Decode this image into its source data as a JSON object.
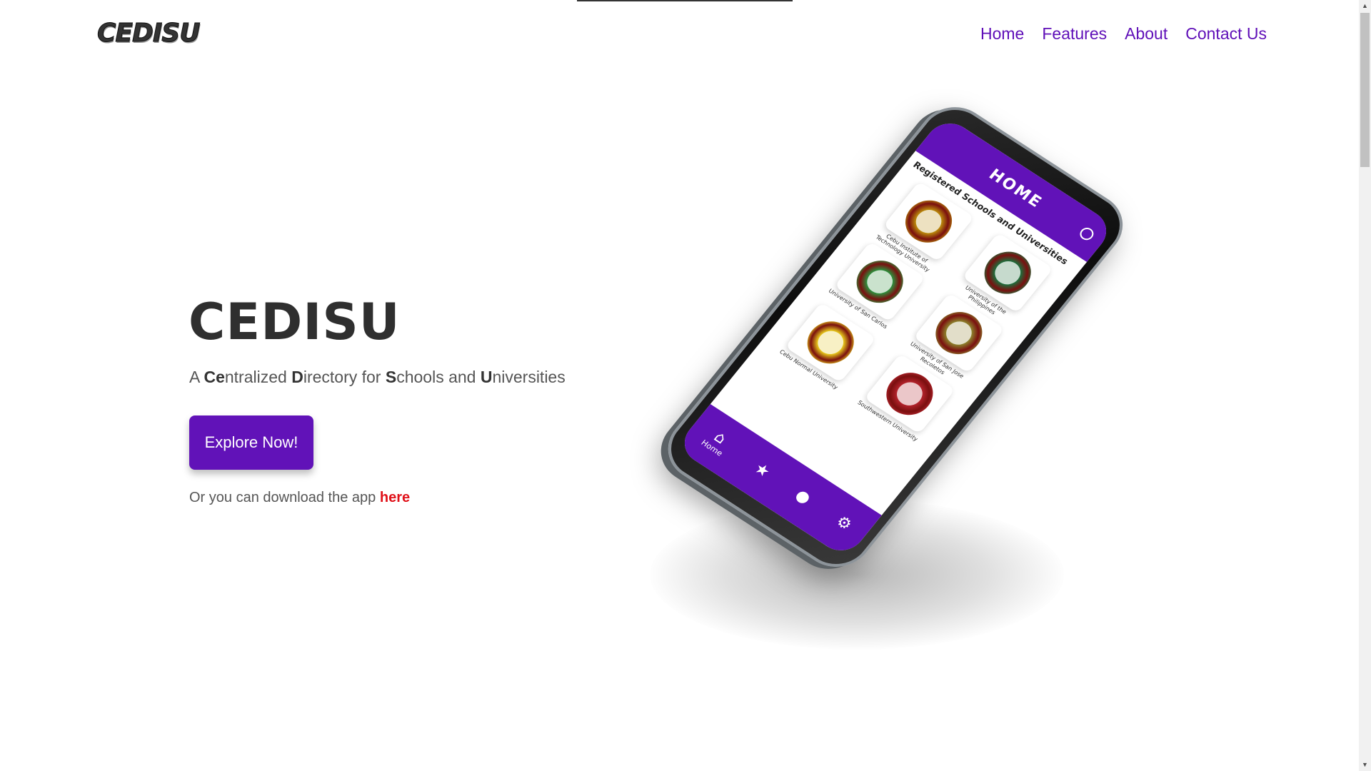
{
  "header": {
    "logo_text": "CEDISU",
    "nav": [
      {
        "label": "Home"
      },
      {
        "label": "Features"
      },
      {
        "label": "About"
      },
      {
        "label": "Contact Us"
      }
    ]
  },
  "hero": {
    "title": "CEDISU",
    "subtitle_parts": [
      {
        "text": "A ",
        "bold": false
      },
      {
        "text": "Ce",
        "bold": true
      },
      {
        "text": "ntralized ",
        "bold": false
      },
      {
        "text": "D",
        "bold": true
      },
      {
        "text": "irectory for ",
        "bold": false
      },
      {
        "text": "S",
        "bold": true
      },
      {
        "text": "chools and ",
        "bold": false
      },
      {
        "text": "U",
        "bold": true
      },
      {
        "text": "niversities",
        "bold": false
      }
    ],
    "cta_label": "Explore Now!",
    "download_prefix": "Or you can download the app ",
    "download_link": "here"
  },
  "phone_app": {
    "header_title": "HOME",
    "section_title": "Registered Schools and Universities",
    "schools": [
      {
        "name": "Cebu Institute of Technology University",
        "seal_color": "#b8860b"
      },
      {
        "name": "University of the Philippines",
        "seal_color": "#1f6b3a"
      },
      {
        "name": "University of San Carlos",
        "seal_color": "#2e8b3a"
      },
      {
        "name": "University of San Jose Recoletos",
        "seal_color": "#8b7d2a"
      },
      {
        "name": "Cebu Normal University",
        "seal_color": "#e3c21a"
      },
      {
        "name": "Southwestern University",
        "seal_color": "#b0222a"
      }
    ],
    "bottom_nav": [
      {
        "icon": "home-icon",
        "glyph": "⌂",
        "label": "Home"
      },
      {
        "icon": "star-icon",
        "glyph": "★",
        "label": ""
      },
      {
        "icon": "user-icon",
        "glyph": "●",
        "label": ""
      },
      {
        "icon": "gear-icon",
        "glyph": "⚙",
        "label": ""
      }
    ]
  },
  "colors": {
    "brand_purple": "#6112b8",
    "nav_link": "#5f0fb8",
    "download_link": "#e0121a"
  }
}
